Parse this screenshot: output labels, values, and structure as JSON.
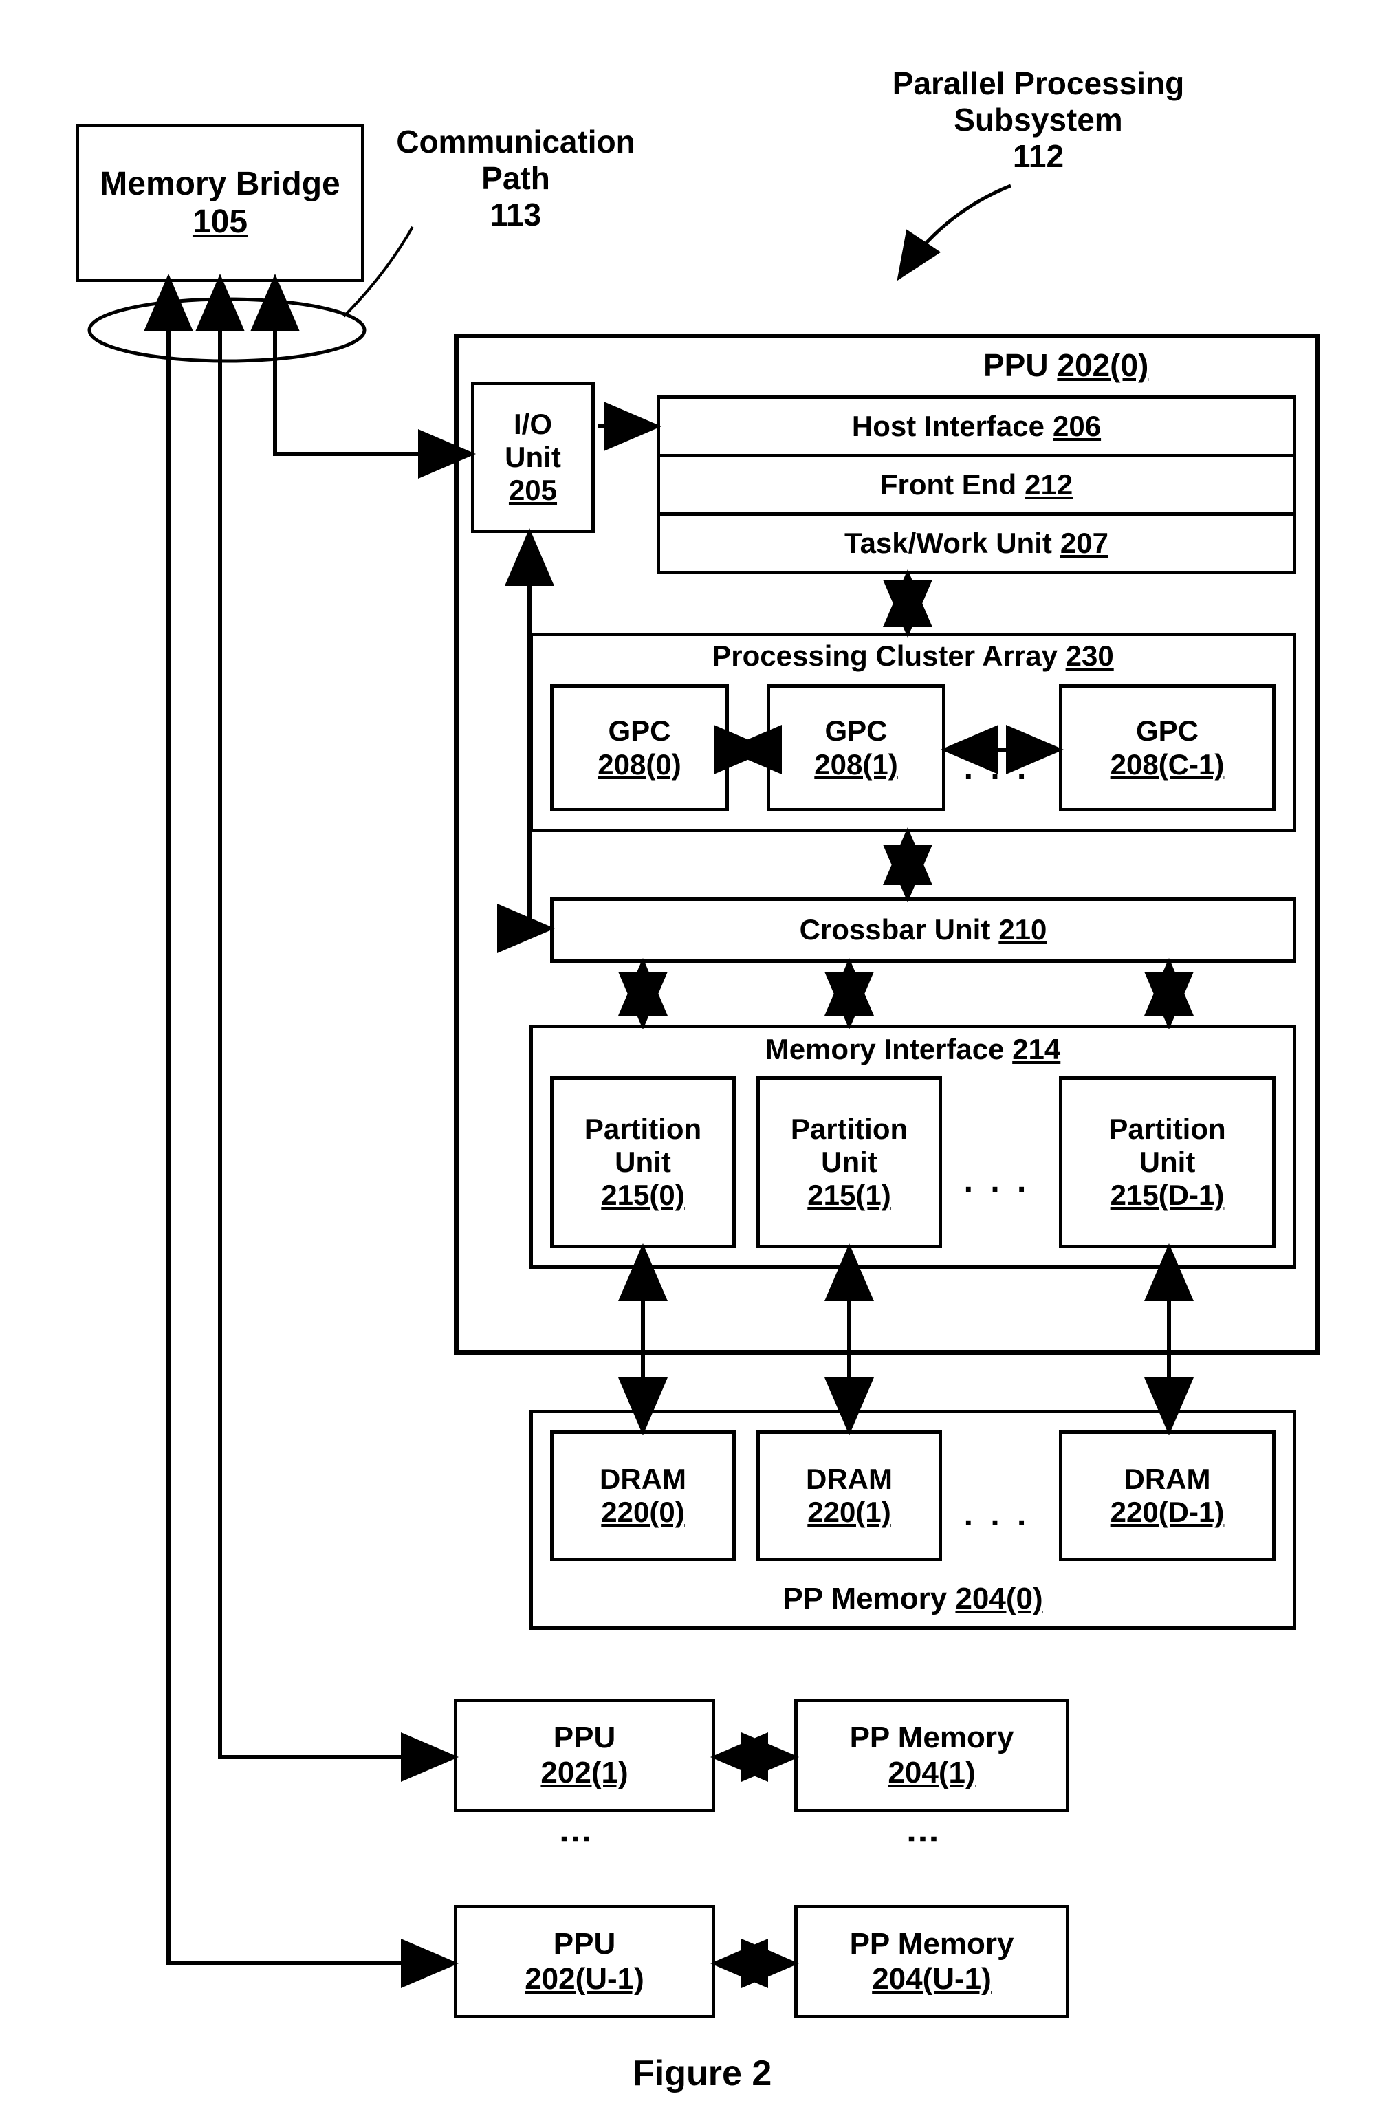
{
  "memoryBridge": {
    "name": "Memory Bridge",
    "ref": "105"
  },
  "commPath": {
    "name": "Communication",
    "name2": "Path",
    "ref": "113"
  },
  "pps": {
    "name": "Parallel Processing",
    "name2": "Subsystem",
    "ref": "112"
  },
  "ppu0": {
    "title": "PPU",
    "ref": "202(0)"
  },
  "io": {
    "name": "I/O",
    "name2": "Unit",
    "ref": "205"
  },
  "host": {
    "name": "Host Interface",
    "ref": "206"
  },
  "front": {
    "name": "Front End",
    "ref": "212"
  },
  "task": {
    "name": "Task/Work Unit",
    "ref": "207"
  },
  "pca": {
    "name": "Processing Cluster Array",
    "ref": "230"
  },
  "gpc0": {
    "name": "GPC",
    "ref": "208(0)"
  },
  "gpc1": {
    "name": "GPC",
    "ref": "208(1)"
  },
  "gpcN": {
    "name": "GPC",
    "ref": "208(C-1)"
  },
  "xbar": {
    "name": "Crossbar Unit",
    "ref": "210"
  },
  "mif": {
    "name": "Memory Interface",
    "ref": "214"
  },
  "pu0": {
    "name": "Partition",
    "name2": "Unit",
    "ref": "215(0)"
  },
  "pu1": {
    "name": "Partition",
    "name2": "Unit",
    "ref": "215(1)"
  },
  "puN": {
    "name": "Partition",
    "name2": "Unit",
    "ref": "215(D-1)"
  },
  "dram0": {
    "name": "DRAM",
    "ref": "220(0)"
  },
  "dram1": {
    "name": "DRAM",
    "ref": "220(1)"
  },
  "dramN": {
    "name": "DRAM",
    "ref": "220(D-1)"
  },
  "ppmem0": {
    "name": "PP Memory",
    "ref": "204(0)"
  },
  "ppu1": {
    "name": "PPU",
    "ref": "202(1)"
  },
  "ppmem1": {
    "name": "PP Memory",
    "ref": "204(1)"
  },
  "ppuU": {
    "name": "PPU",
    "ref": "202(U-1)"
  },
  "ppmemU": {
    "name": "PP Memory",
    "ref": "204(U-1)"
  },
  "dots": ". . .",
  "vdots": "...",
  "figure": "Figure 2"
}
